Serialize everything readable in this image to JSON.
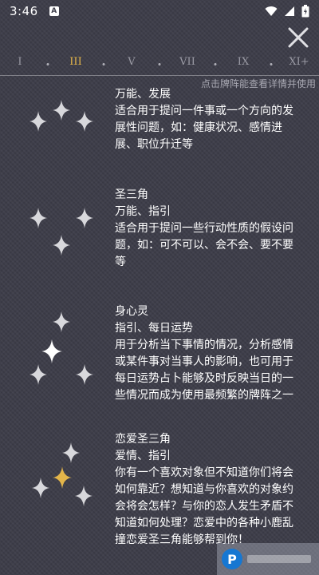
{
  "status_bar": {
    "time": "3:46",
    "notification_letter": "A"
  },
  "nav": {
    "items": [
      {
        "label": "I",
        "active": false
      },
      {
        "label": "III",
        "active": true
      },
      {
        "label": "V",
        "active": false
      },
      {
        "label": "VII",
        "active": false
      },
      {
        "label": "IX",
        "active": false
      },
      {
        "label": "XI+",
        "active": false
      }
    ]
  },
  "hint": "点击牌阵能查看详情并使用",
  "colors": {
    "background": "#3c3c48",
    "accent": "#e3b54a",
    "star": "#d8d8dc",
    "star_highlight": "#ffffff"
  },
  "spreads": [
    {
      "title": "万能、发展",
      "tags": "",
      "lines": [
        "适合用于提问一件事或一个方向的发",
        "展性问题，如：健康状况、感情进",
        "展、职位升迁等"
      ]
    },
    {
      "title": "圣三角",
      "tags": "万能、指引",
      "lines": [
        "适合用于提问一些行动性质的假设问",
        "题，如：可不可以、会不会、要不要",
        "等"
      ]
    },
    {
      "title": "身心灵",
      "tags": "指引、每日运势",
      "lines": [
        "用于分析当下事情的情况，分析感情",
        "或某件事对当事人的影响，也可用于",
        "每日运势占卜能够及时反映当日的一",
        "些情况而成为使用最频繁的牌阵之一"
      ]
    },
    {
      "title": "恋爱圣三角",
      "tags": "爱情、指引",
      "lines": [
        "你有一个喜欢对象但不知道你们将会",
        "如何靠近？想知道与你喜欢的对象约",
        "会将会怎样？与你的恋人发生矛盾不",
        "知道如何处理？恋爱中的各种小鹿乱",
        "撞恋爱圣三角能够帮到你！"
      ]
    }
  ]
}
